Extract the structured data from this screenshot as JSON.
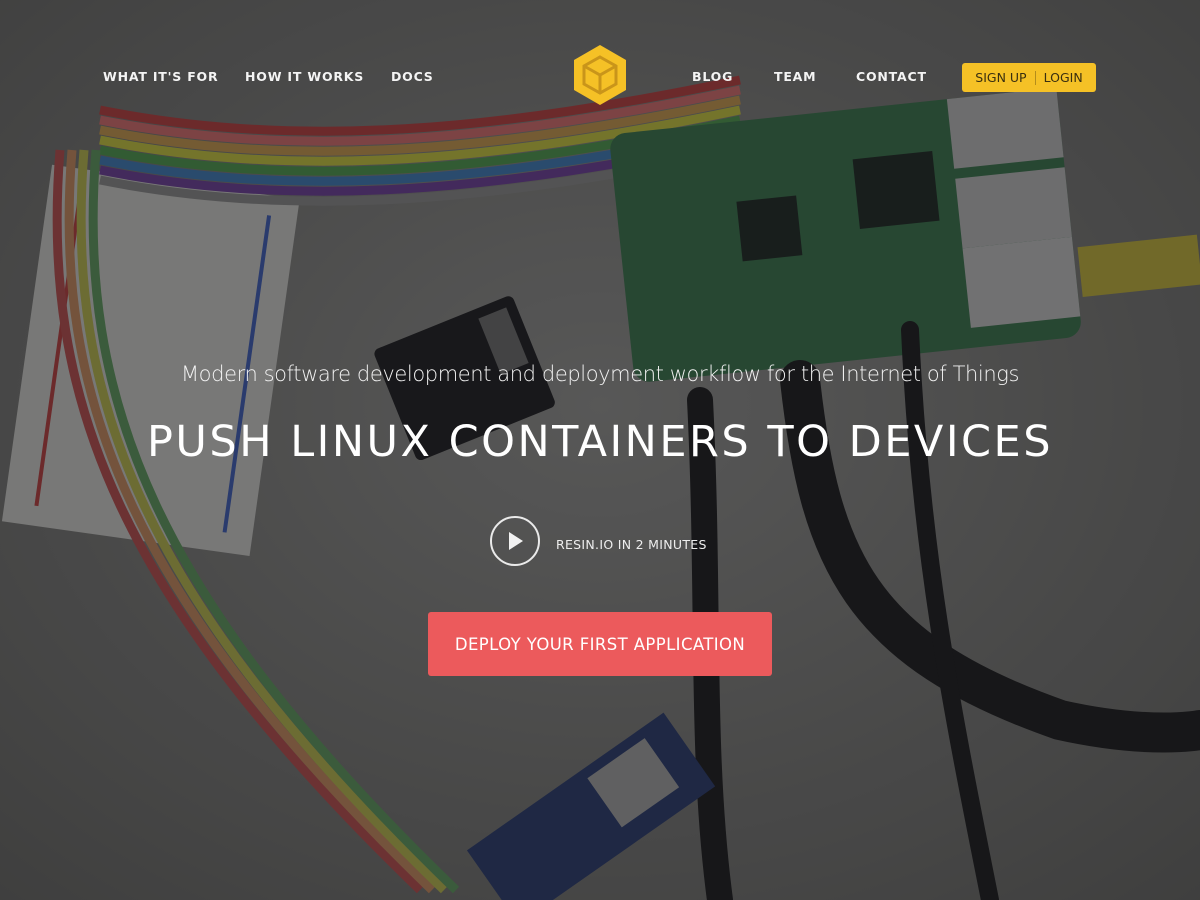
{
  "nav": {
    "left": [
      {
        "label": "WHAT IT'S FOR"
      },
      {
        "label": "HOW IT WORKS"
      },
      {
        "label": "DOCS"
      }
    ],
    "right": [
      {
        "label": "BLOG"
      },
      {
        "label": "TEAM"
      },
      {
        "label": "CONTACT"
      }
    ],
    "logo_icon": "hexagon-cube-icon",
    "auth": {
      "signup": "SIGN UP",
      "login": "LOGIN"
    }
  },
  "hero": {
    "tagline": "Modern software development and deployment workflow for the Internet of Things",
    "headline": "PUSH LINUX CONTAINERS TO DEVICES",
    "video": {
      "icon": "play-icon",
      "label": "RESIN.IO IN 2 MINUTES"
    },
    "cta": "DEPLOY YOUR FIRST APPLICATION",
    "background_image": "raspberry-pi-board-with-cables-photo"
  },
  "colors": {
    "accent_yellow": "#f5c126",
    "cta_red": "#ec5a5c",
    "overlay": "#141416"
  }
}
